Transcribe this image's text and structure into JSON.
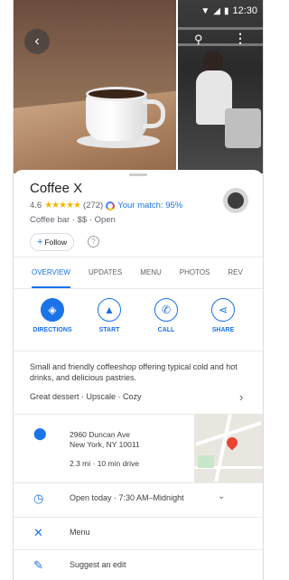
{
  "status": {
    "time": "12:30"
  },
  "place": {
    "name": "Coffee X",
    "rating": "4.6",
    "stars": "★★★★★",
    "reviews": "(272)",
    "match": "Your match: 95%",
    "category": "Coffee bar · $$",
    "status": "· Open"
  },
  "follow": {
    "plus": "+",
    "label": "Follow"
  },
  "tabs": [
    "OVERVIEW",
    "UPDATES",
    "MENU",
    "PHOTOS",
    "REV"
  ],
  "actions": [
    {
      "label": "DIRECTIONS",
      "glyph": "◈"
    },
    {
      "label": "START",
      "glyph": "▲"
    },
    {
      "label": "CALL",
      "glyph": "✆"
    },
    {
      "label": "SHARE",
      "glyph": "⋖"
    }
  ],
  "description": "Small and friendly coffeeshop offering typical cold and hot drinks, and delicious pastries.",
  "tags": "Great dessert · Upscale · Cozy",
  "address": {
    "line1": "2960 Duncan Ave",
    "line2": "New York, NY 10011",
    "distance": "2.3 mi · 10 min drive"
  },
  "hours": "Open today · 7:30 AM–Midnight",
  "menu": "Menu",
  "edit": "Suggest an edit",
  "colors": {
    "accent": "#1a73e8",
    "star": "#f4b400",
    "pin": "#ea4335"
  }
}
